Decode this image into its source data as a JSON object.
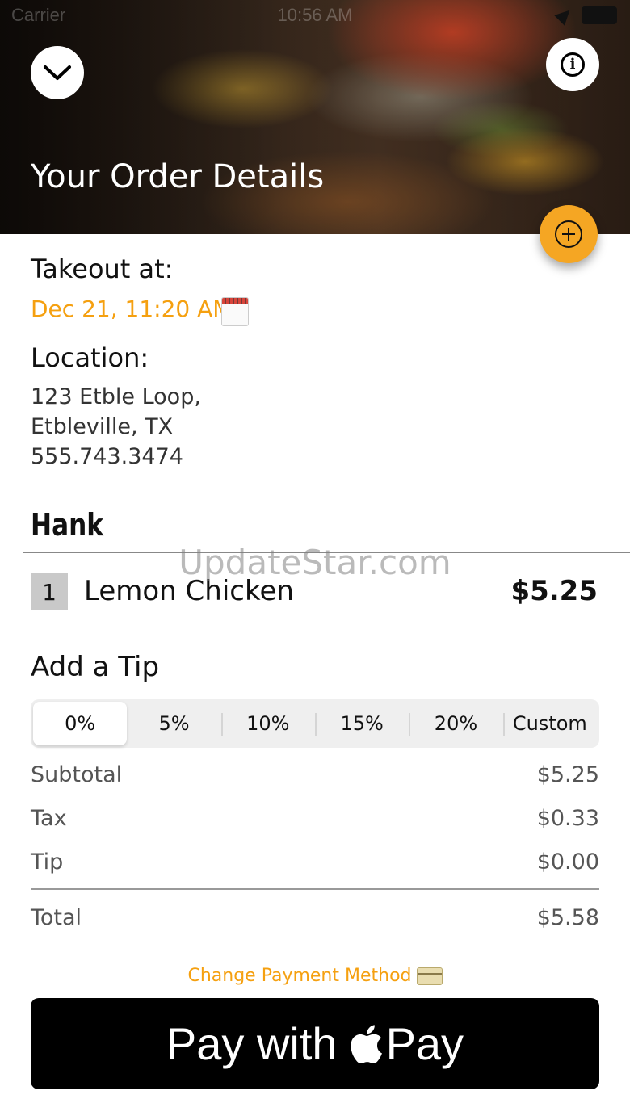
{
  "status_bar": {
    "carrier": "Carrier",
    "time": "10:56 AM"
  },
  "header": {
    "title": "Your Order Details"
  },
  "takeout": {
    "label": "Takeout at:",
    "datetime": "Dec 21, 11:20 AM"
  },
  "location": {
    "label": "Location:",
    "address_line1": "123 Etble Loop,",
    "address_line2": "Etbleville, TX",
    "phone": "555.743.3474"
  },
  "order": {
    "name": "Hank",
    "items": [
      {
        "qty": "1",
        "name": "Lemon Chicken",
        "price": "$5.25"
      }
    ]
  },
  "watermark": "UpdateStar.com",
  "tip": {
    "label": "Add a Tip",
    "options": [
      "0%",
      "5%",
      "10%",
      "15%",
      "20%",
      "Custom"
    ],
    "selected": "0%"
  },
  "summary": {
    "subtotal_label": "Subtotal",
    "subtotal": "$5.25",
    "tax_label": "Tax",
    "tax": "$0.33",
    "tip_label": "Tip",
    "tip": "$0.00",
    "total_label": "Total",
    "total": "$5.58"
  },
  "payment": {
    "change_label": "Change Payment Method",
    "apple_pay_prefix": "Pay with",
    "apple_pay_suffix": "Pay"
  },
  "colors": {
    "accent": "#f5a010",
    "fab": "#f5a623",
    "pay_button": "#000000"
  },
  "icons": [
    "chevron-down-icon",
    "info-icon",
    "add-icon",
    "calendar-icon",
    "credit-card-icon",
    "apple-logo-icon"
  ]
}
